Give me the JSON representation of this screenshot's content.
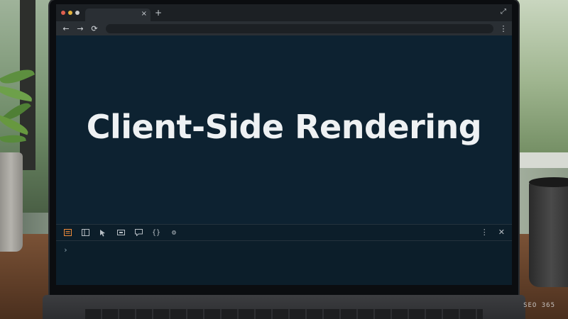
{
  "browser": {
    "tab_close": "×",
    "new_tab": "+",
    "expand": "⤢",
    "back": "←",
    "forward": "→",
    "reload": "⟳",
    "menu": "⋮",
    "traffic_colors": [
      "#e0604f",
      "#e3b23c",
      "#c9c9c9"
    ]
  },
  "page": {
    "heading": "Client-Side Rendering"
  },
  "devtools": {
    "tools": [
      {
        "name": "elements-panel-icon",
        "glyph": "▤"
      },
      {
        "name": "dock-side-icon",
        "glyph": "◫"
      },
      {
        "name": "inspect-cursor-icon",
        "glyph": "↖"
      },
      {
        "name": "device-toggle-icon",
        "glyph": "▭"
      },
      {
        "name": "console-comment-icon",
        "glyph": "▢"
      },
      {
        "name": "sources-braces-icon",
        "glyph": "{}"
      },
      {
        "name": "settings-gear-icon",
        "glyph": "⚙"
      }
    ],
    "menu": "⋮",
    "close": "✕",
    "prompt": "›",
    "accent": "#f08c3a"
  },
  "watermark": "SEO 365"
}
